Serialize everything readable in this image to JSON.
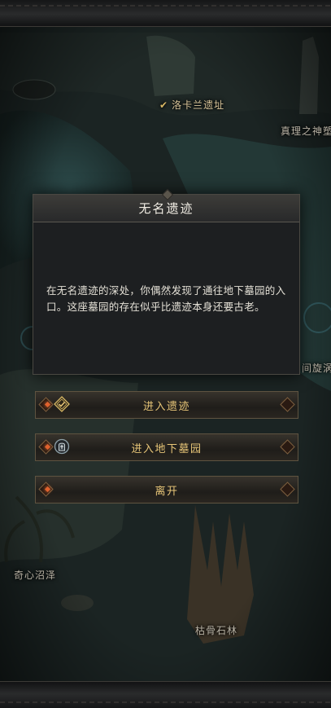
{
  "map_locations": {
    "luokalan": "洛卡兰遗址",
    "truth_temple": "真理之神塑",
    "vortex": "间旋涡",
    "swamp": "奇心沼泽",
    "bone_forest": "枯骨石林"
  },
  "dialog": {
    "title": "无名遗迹",
    "body": "在无名遗迹的深处，你偶然发现了通往地下墓园的入口。这座墓园的存在似乎比遗迹本身还要古老。"
  },
  "choices": [
    {
      "label": "进入遗迹",
      "icon": "quest-diamond-icon"
    },
    {
      "label": "进入地下墓园",
      "icon": "tomb-icon"
    },
    {
      "label": "离开",
      "icon": ""
    }
  ],
  "colors": {
    "accent": "#e8c678",
    "ember": "#e0622e"
  }
}
